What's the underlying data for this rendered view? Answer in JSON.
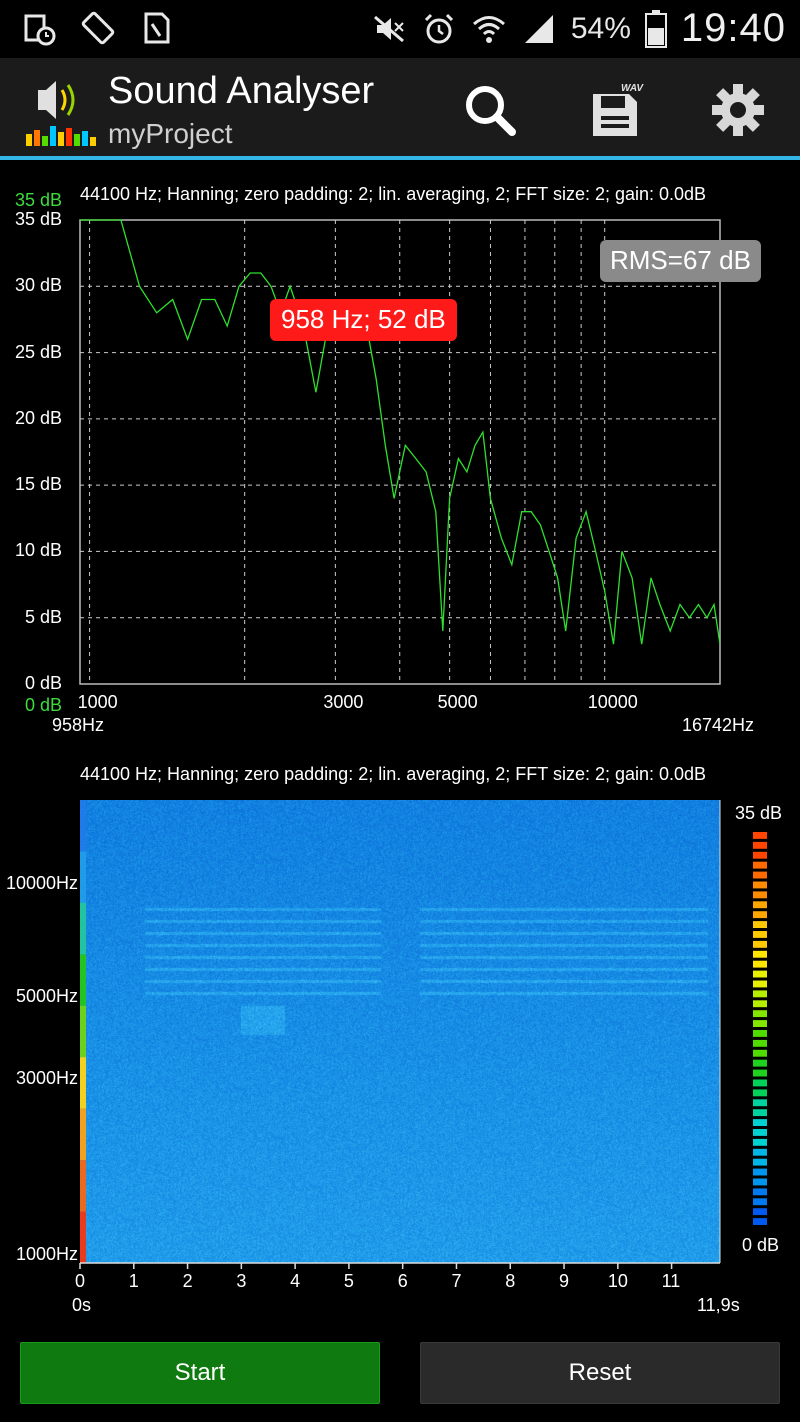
{
  "status_bar": {
    "battery": "54%",
    "clock": "19:40",
    "icons_left": [
      "calendar-clock-icon",
      "rotation-icon",
      "sim-card-icon"
    ],
    "icons_right": [
      "mute-icon",
      "alarm-icon",
      "wifi-icon",
      "signal-icon",
      "battery-icon"
    ]
  },
  "app_bar": {
    "title": "Sound Analyser",
    "subtitle": "myProject",
    "actions": [
      "search-icon",
      "save-wav-icon",
      "gear-icon"
    ],
    "save_badge": "WAV"
  },
  "spectrum": {
    "caption": "44100 Hz; Hanning; zero padding: 2; lin. averaging, 2; FFT size: 2; gain: 0.0dB",
    "ytop_green": "35 dB",
    "ybottom_green": "0 dB",
    "x_min_label": "958Hz",
    "x_max_label": "16742Hz",
    "rms": "RMS=67 dB",
    "peak": "958 Hz; 52 dB"
  },
  "spectrogram": {
    "caption": "44100 Hz; Hanning; zero padding: 2; lin. averaging, 2; FFT size: 2; gain: 0.0dB",
    "x_start_label": "0s",
    "x_end_label": "11,9s",
    "scale_top": "35 dB",
    "scale_bottom": "0 dB"
  },
  "buttons": {
    "start": "Start",
    "reset": "Reset"
  },
  "chart_data": [
    {
      "type": "line",
      "xscale": "log",
      "xlim": [
        958,
        16742
      ],
      "ylim": [
        0,
        35
      ],
      "y_ticks": [
        "0 dB",
        "5 dB",
        "10 dB",
        "15 dB",
        "20 dB",
        "25 dB",
        "30 dB",
        "35 dB"
      ],
      "x_ticks": [
        "1000",
        "3000",
        "5000",
        "10000"
      ],
      "x": [
        958,
        1050,
        1150,
        1250,
        1350,
        1450,
        1550,
        1650,
        1750,
        1850,
        1950,
        2050,
        2150,
        2250,
        2350,
        2450,
        2600,
        2750,
        2900,
        3000,
        3150,
        3300,
        3450,
        3600,
        3750,
        3900,
        4100,
        4300,
        4500,
        4700,
        4850,
        5000,
        5200,
        5400,
        5600,
        5800,
        6000,
        6300,
        6600,
        6900,
        7200,
        7500,
        7800,
        8100,
        8400,
        8800,
        9200,
        9600,
        10000,
        10400,
        10800,
        11300,
        11800,
        12300,
        12800,
        13400,
        14000,
        14600,
        15200,
        15800,
        16300,
        16742
      ],
      "y": [
        35,
        35,
        35,
        30,
        28,
        29,
        26,
        29,
        29,
        27,
        30,
        31,
        31,
        30,
        28,
        30,
        27,
        22,
        27,
        28,
        27,
        26,
        27,
        23,
        18,
        14,
        18,
        17,
        16,
        13,
        4,
        14,
        17,
        16,
        18,
        19,
        14,
        11,
        9,
        13,
        13,
        12,
        10,
        8,
        4,
        11,
        13,
        10,
        7,
        3,
        10,
        8,
        3,
        8,
        6,
        4,
        6,
        5,
        6,
        5,
        6,
        3
      ]
    },
    {
      "type": "heatmap",
      "xlim": [
        0,
        11.9
      ],
      "x_ticks": [
        "0",
        "1",
        "2",
        "3",
        "4",
        "5",
        "6",
        "7",
        "8",
        "9",
        "10",
        "11"
      ],
      "y_ticks": [
        "1000Hz",
        "3000Hz",
        "5000Hz",
        "10000Hz"
      ],
      "zlim": [
        0,
        35
      ]
    }
  ]
}
